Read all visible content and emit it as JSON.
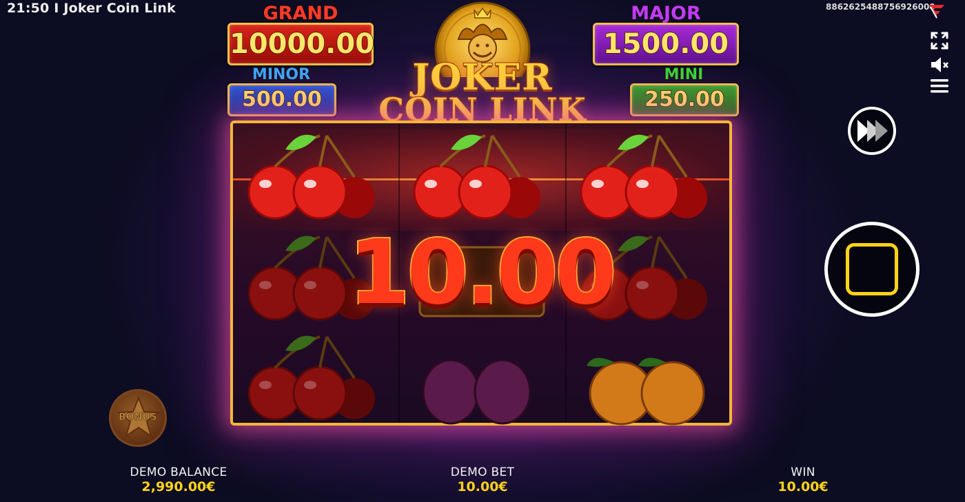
{
  "topbar": {
    "time_title": "21:50 I Joker Coin Link",
    "session_id": "8862625488756926000"
  },
  "icons": {
    "brand": "brand-logo-icon",
    "fullscreen": "fullscreen-icon",
    "sound": "sound-muted-icon",
    "menu": "hamburger-menu-icon",
    "turbo": "fast-forward-icon",
    "spin": "spin-icon",
    "bonus": "bonus-star-icon"
  },
  "jackpots": {
    "grand": {
      "label": "GRAND",
      "value": "10000.00"
    },
    "major": {
      "label": "MAJOR",
      "value": "1500.00"
    },
    "minor": {
      "label": "MINOR",
      "value": "500.00"
    },
    "mini": {
      "label": "MINI",
      "value": "250.00"
    }
  },
  "logo": {
    "line1": "JOKER",
    "line2": "COIN LINK"
  },
  "reels": {
    "rows": [
      [
        "cherry",
        "cherry",
        "cherry"
      ],
      [
        "cherry",
        "bonus",
        "cherry"
      ],
      [
        "cherry",
        "plum",
        "orange"
      ]
    ],
    "win_amount": "10.00"
  },
  "bonus_button": {
    "label": "BONUS"
  },
  "footer": {
    "balance": {
      "label": "DEMO BALANCE",
      "value": "2,990.00€"
    },
    "bet": {
      "label": "DEMO BET",
      "value": "10.00€"
    },
    "win": {
      "label": "WIN",
      "value": "10.00€"
    }
  },
  "colors": {
    "accent_gold": "#ffd31a",
    "grand": "#d8241a",
    "major": "#a82ad8",
    "minor": "#2a5ad8",
    "mini": "#3aa42a"
  }
}
